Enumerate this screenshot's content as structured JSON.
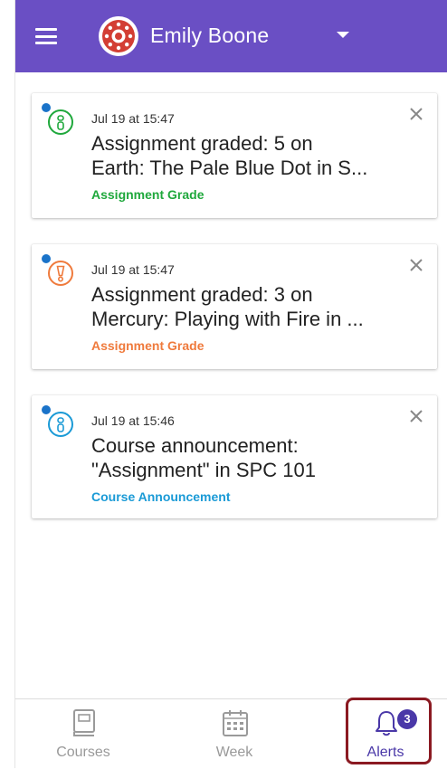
{
  "header": {
    "user_name": "Emily Boone",
    "background_color": "#6a4fc4",
    "menu_icon": "hamburger-icon",
    "logo_icon": "canvas-logo-icon",
    "dropdown_icon": "caret-down-icon"
  },
  "alerts": [
    {
      "date": "Jul 19 at 15:47",
      "title": "Assignment graded: 5 on\nEarth: The Pale Blue Dot in S...",
      "type": "Assignment Grade",
      "color": "#1fa83c",
      "unread": true,
      "icon": "info-icon"
    },
    {
      "date": "Jul 19 at 15:47",
      "title": "Assignment graded: 3 on\nMercury: Playing with Fire in ...",
      "type": "Assignment Grade",
      "color": "#ef7a3c",
      "unread": true,
      "icon": "warning-icon"
    },
    {
      "date": "Jul 19 at 15:46",
      "title": "Course announcement:\n\"Assignment\" in SPC 101",
      "type": "Course Announcement",
      "color": "#1a9ad6",
      "unread": true,
      "icon": "info-icon"
    }
  ],
  "bottom_nav": {
    "items": [
      {
        "label": "Courses",
        "icon": "book-icon",
        "color": "#999999"
      },
      {
        "label": "Week",
        "icon": "calendar-icon",
        "color": "#999999"
      },
      {
        "label": "Alerts",
        "icon": "bell-icon",
        "color": "#4a38a8",
        "badge": "3",
        "selected": true
      }
    ],
    "highlight_color": "#8b1a22"
  }
}
